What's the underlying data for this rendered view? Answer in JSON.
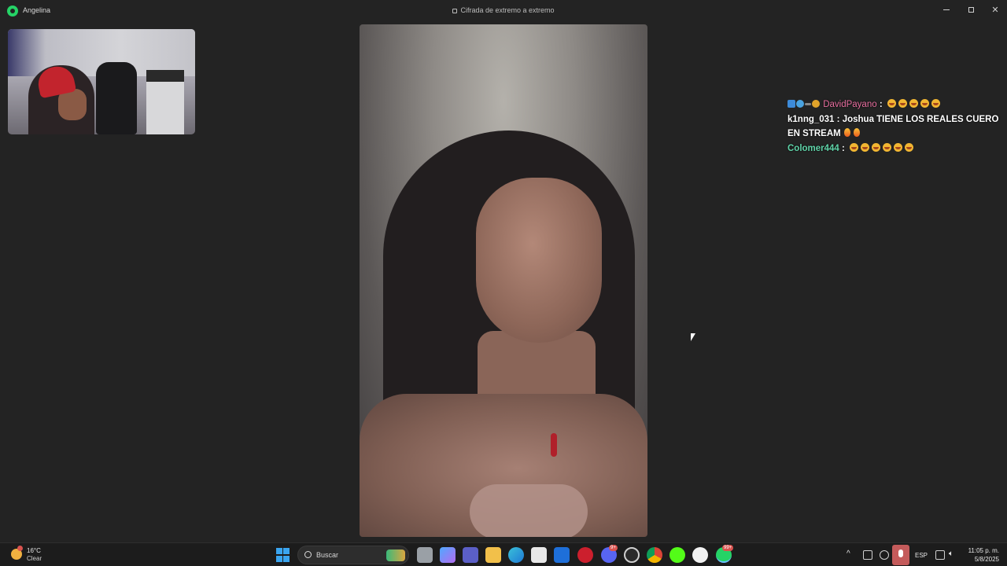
{
  "window": {
    "title": "Angelina",
    "encryption_label": "Cifrada de extremo a extremo"
  },
  "chat_overlay": {
    "messages": [
      {
        "user": "DavidPayano",
        "separator": ":",
        "text": "",
        "emoji_count": 5,
        "user_color": "#e86fa0"
      },
      {
        "user": "k1nng_031",
        "separator": ":",
        "text": "Joshua TIENE LOS REALES CUERO EN STREAM",
        "fire_count": 2,
        "user_color": "#ffffff"
      },
      {
        "user": "Colomer444",
        "separator": ":",
        "text": "",
        "emoji_count": 6,
        "user_color": "#5fd3a8"
      }
    ]
  },
  "taskbar": {
    "weather": {
      "temp": "16°C",
      "condition": "Clear",
      "badge": "1"
    },
    "search_placeholder": "Buscar",
    "discord_badge": "9+",
    "whatsapp_badge": "99+",
    "language": "ESP",
    "time": "11:05 p. m.",
    "date": "5/8/2025"
  },
  "colors": {
    "background": "#232323",
    "taskbar": "#1c1c1c",
    "whatsapp_green": "#25d366",
    "mic_active": "#c45b5b"
  }
}
